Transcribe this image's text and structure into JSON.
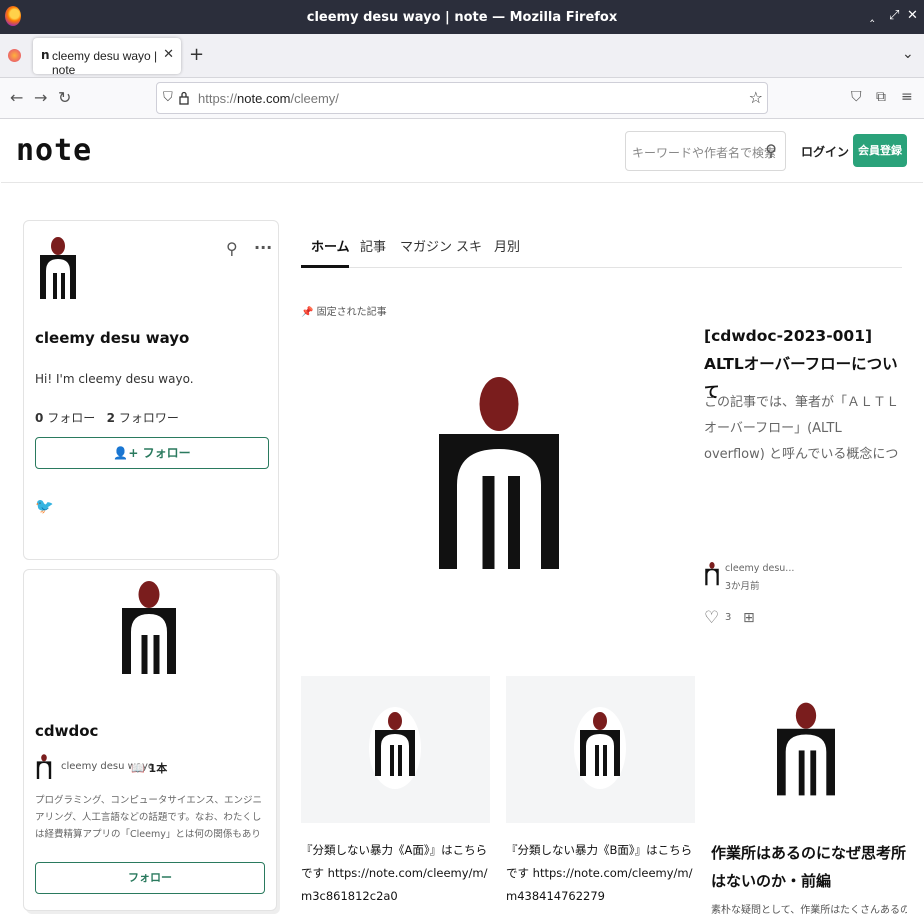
{
  "window": {
    "title": "cleemy desu wayo | note — Mozilla Firefox",
    "controls": [
      "‸",
      "⤢",
      "✕"
    ]
  },
  "browser": {
    "tab_label": "cleemy desu wayo | note",
    "tab_icon": "n",
    "url_proto": "https://",
    "url_host": "note.com",
    "url_path": "/cleemy/"
  },
  "header": {
    "logo": "note",
    "search_placeholder": "キーワードや作者名で検索",
    "login_label": "ログイン",
    "signup_label": "会員登録"
  },
  "profile": {
    "name": "cleemy desu wayo",
    "bio": "Hi! I'm cleemy desu wayo.",
    "following_count": "0",
    "following_label": "フォロー",
    "followers_count": "2",
    "followers_label": "フォロワー",
    "follow_label": "フォロー"
  },
  "magazine": {
    "title": "cdwdoc",
    "author": "cleemy desu wayo",
    "count": "1本",
    "description": "プログラミング、コンピュータサイエンス、エンジニアリング、人工言語などの話題です。なお、わたくしは経費精算アプリの「Cleemy」とは何の関係もありません。I have absolutely nothing to do with ...",
    "follow_label": "フォロー"
  },
  "tabs": [
    "ホーム",
    "記事",
    "マガジン",
    "スキ",
    "月別"
  ],
  "pinned_label": "固定された記事",
  "featured": {
    "title": "[cdwdoc-2023-001] ALTLオーバーフローについて",
    "excerpt": "この記事では、筆者が「ＡＬＴＬオーバーフロー」(ALTL overflow) と呼んでいる概念について解説する。「ALTLオ...",
    "author": "cleemy desu...",
    "date": "3か月前",
    "likes": "3"
  },
  "posts": [
    {
      "title": "『分類しない暴力《A面》』はこちらです https://note.com/cleemy/m/m3c861812c2a0"
    },
    {
      "title": "『分類しない暴力《B面》』はこちらです https://note.com/cleemy/m/m438414762279"
    },
    {
      "title": "作業所はあるのになぜ思考所はないのか・前編",
      "excerpt": "素朴な疑問として、作業所はたくさんあるのに、どうして"
    }
  ],
  "colors": {
    "accent": "#2aa27a",
    "logo_head": "#7a1d1d"
  }
}
